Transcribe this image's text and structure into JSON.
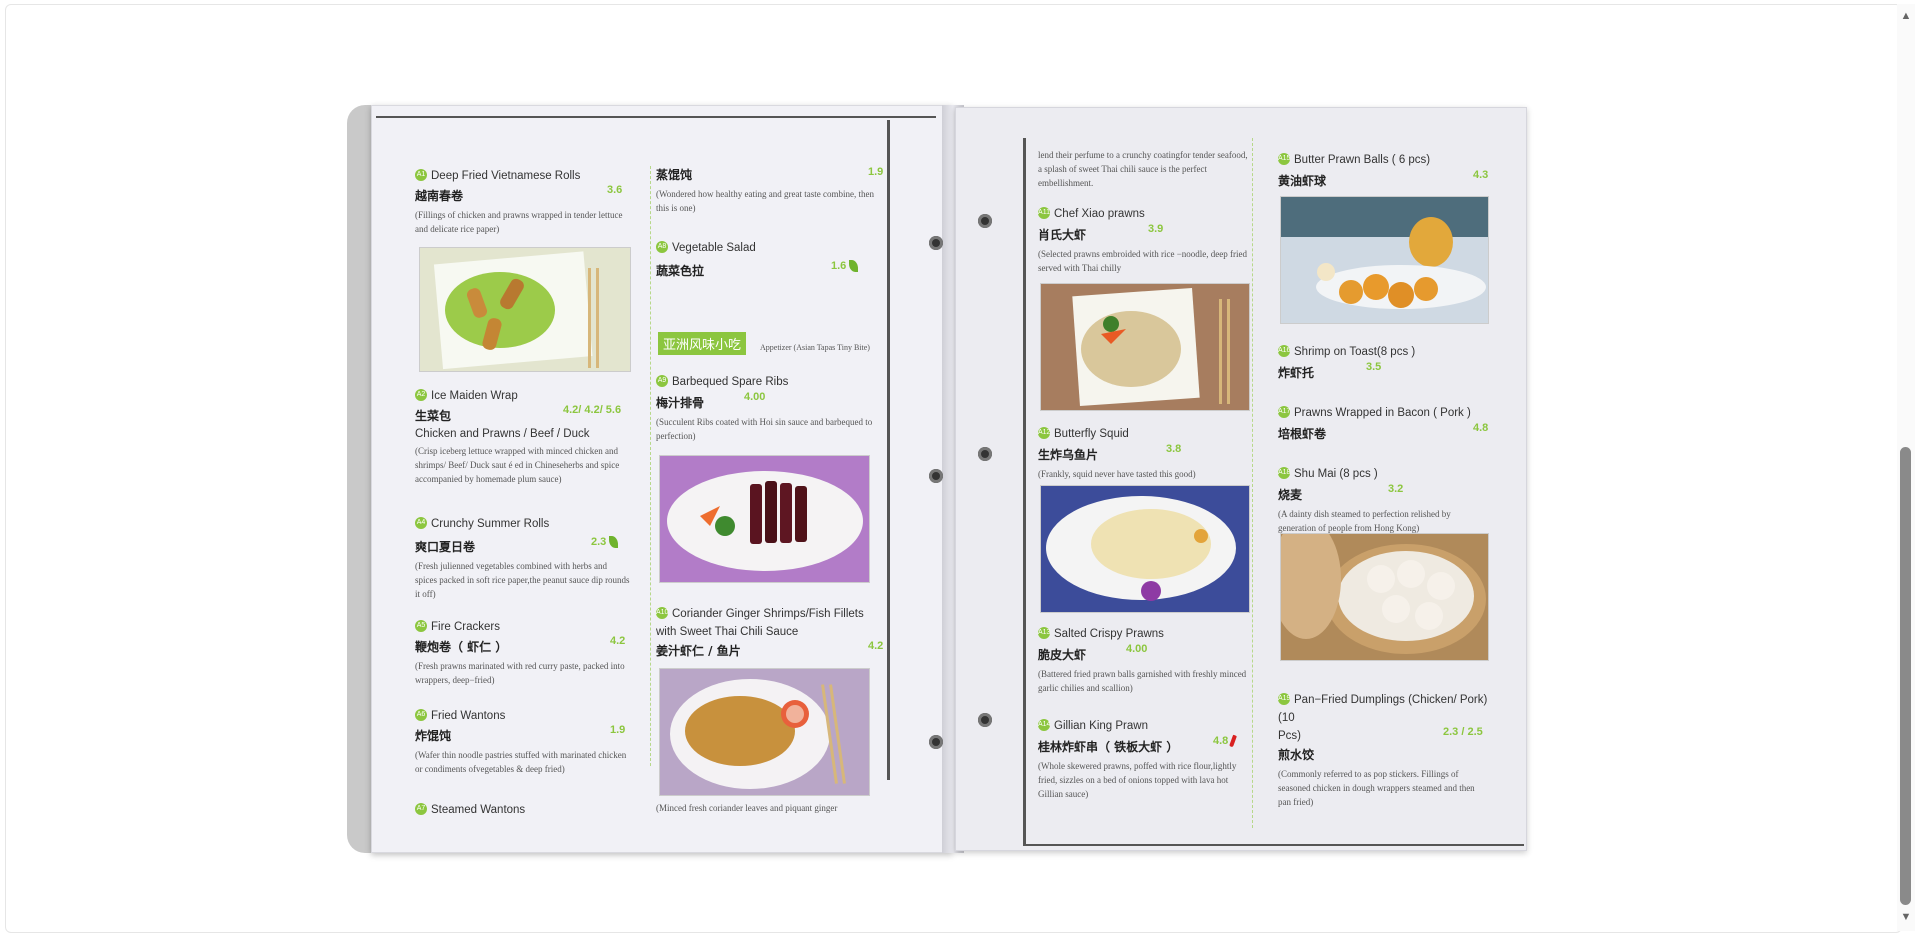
{
  "colors": {
    "accent": "#8cc63f",
    "text": "#333333",
    "chili": "#d92121"
  },
  "scrollbar": {
    "up_icon": "▲",
    "down_icon": "▼"
  },
  "left_page": {
    "col1": [
      {
        "num": "A1",
        "en": "Deep Fried Vietnamese Rolls",
        "zh": "越南春卷",
        "price": "3.6",
        "desc": "(Fillings of chicken and prawns wrapped in tender lettuce and delicate rice paper)"
      },
      {
        "num": "A2",
        "en": "Ice Maiden Wrap",
        "zh": "生菜包",
        "price": "4.2/ 4.2/ 5.6",
        "en2": "Chicken and Prawns / Beef / Duck",
        "desc": "(Crisp iceberg lettuce wrapped with minced chicken and shrimps/ Beef/ Duck saut é ed in Chineseherbs and spice accompanied by homemade plum sauce)"
      },
      {
        "num": "A4",
        "en": "Crunchy Summer Rolls",
        "zh": "爽口夏日卷",
        "price": "2.3",
        "desc": "(Fresh julienned vegetables combined with herbs and spices packed in soft rice paper,the peanut sauce dip rounds it off)"
      },
      {
        "num": "A5",
        "en": "Fire Crackers",
        "zh": "鞭炮卷（ 虾仁 ）",
        "price": "4.2",
        "desc": "(Fresh prawns marinated with red curry paste, packed into wrappers, deep−fried)"
      },
      {
        "num": "A6",
        "en": "Fried Wantons",
        "zh": "炸馄饨",
        "price": "1.9",
        "desc": "(Wafer thin noodle pastries stuffed with marinated chicken or condiments ofvegetables & deep fried)"
      },
      {
        "num": "A7",
        "en": "Steamed Wantons"
      }
    ],
    "col2": [
      {
        "zh": "蒸馄饨",
        "price": "1.9",
        "desc": "(Wondered how healthy eating and great taste combine, then this is one)"
      },
      {
        "num": "A8",
        "en": "Vegetable Salad",
        "zh": "蔬菜色拉",
        "price": "1.6"
      },
      {
        "badge": "亚洲风味小吃",
        "badge_sub": "Appetizer (Asian Tapas Tiny Bite)"
      },
      {
        "num": "A9",
        "en": "Barbequed Spare Ribs",
        "zh": "梅汁排骨",
        "price": "4.00",
        "desc": "(Succulent Ribs coated with Hoi sin sauce and barbequed to perfection)"
      },
      {
        "num": "A10",
        "en": "Coriander Ginger Shrimps/Fish Fillets",
        "en2": "with Sweet Thai Chili Sauce",
        "zh": "姜汁虾仁 / 鱼片",
        "price": "4.2",
        "desc": "(Minced fresh coriander leaves and piquant ginger"
      }
    ]
  },
  "right_page": {
    "col1": [
      {
        "desc": "lend their perfume to a crunchy coatingfor tender seafood, a splash of sweet Thai chili sauce is the perfect embellishment."
      },
      {
        "num": "A11",
        "en": "Chef  Xiao prawns",
        "zh": "肖氏大虾",
        "price": "3.9",
        "desc": "(Selected prawns embroided with rice −noodle, deep fried served with Thai chilly"
      },
      {
        "num": "A12",
        "en": "Butterfly Squid",
        "zh": "生炸乌鱼片",
        "price": "3.8",
        "desc": "(Frankly, squid never have tasted this good)"
      },
      {
        "num": "A13",
        "en": "Salted Crispy Prawns",
        "zh": "脆皮大虾",
        "price": "4.00",
        "desc": "(Battered fried prawn balls garnished with freshly minced garlic chilies and scallion)"
      },
      {
        "num": "A14",
        "en": "Gillian King  Prawn",
        "zh": "桂林炸虾串（ 铁板大虾 ）",
        "price": "4.8",
        "desc": "(Whole skewered prawns, poffed with rice flour,lightly fried, sizzles on a bed of onions topped with lava hot Gillian sauce)"
      }
    ],
    "col2": [
      {
        "num": "A15",
        "en": "Butter Prawn Balls ( 6 pcs)",
        "zh": "黄油虾球",
        "price": "4.3"
      },
      {
        "num": "A16",
        "en": "Shrimp on Toast(8 pcs )",
        "zh": "炸虾托",
        "price": "3.5"
      },
      {
        "num": "A17",
        "en": "Prawns Wrapped in Bacon ( Pork )",
        "zh": "培根虾卷",
        "price": "4.8"
      },
      {
        "num": "A18",
        "en": "Shu Mai (8 pcs )",
        "zh": "烧麦",
        "price": "3.2",
        "desc": "(A dainty dish steamed to perfection relished by generation of people from Hong Kong)"
      },
      {
        "num": "A19",
        "en": "Pan−Fried Dumplings (Chicken/ Pork) (10",
        "en2": "Pcs)",
        "zh": "煎水饺",
        "price": "2.3 / 2.5",
        "desc": "(Commonly referred to as pop stickers. Fillings of seasoned chicken in dough wrappers steamed and then pan fried)"
      }
    ]
  }
}
